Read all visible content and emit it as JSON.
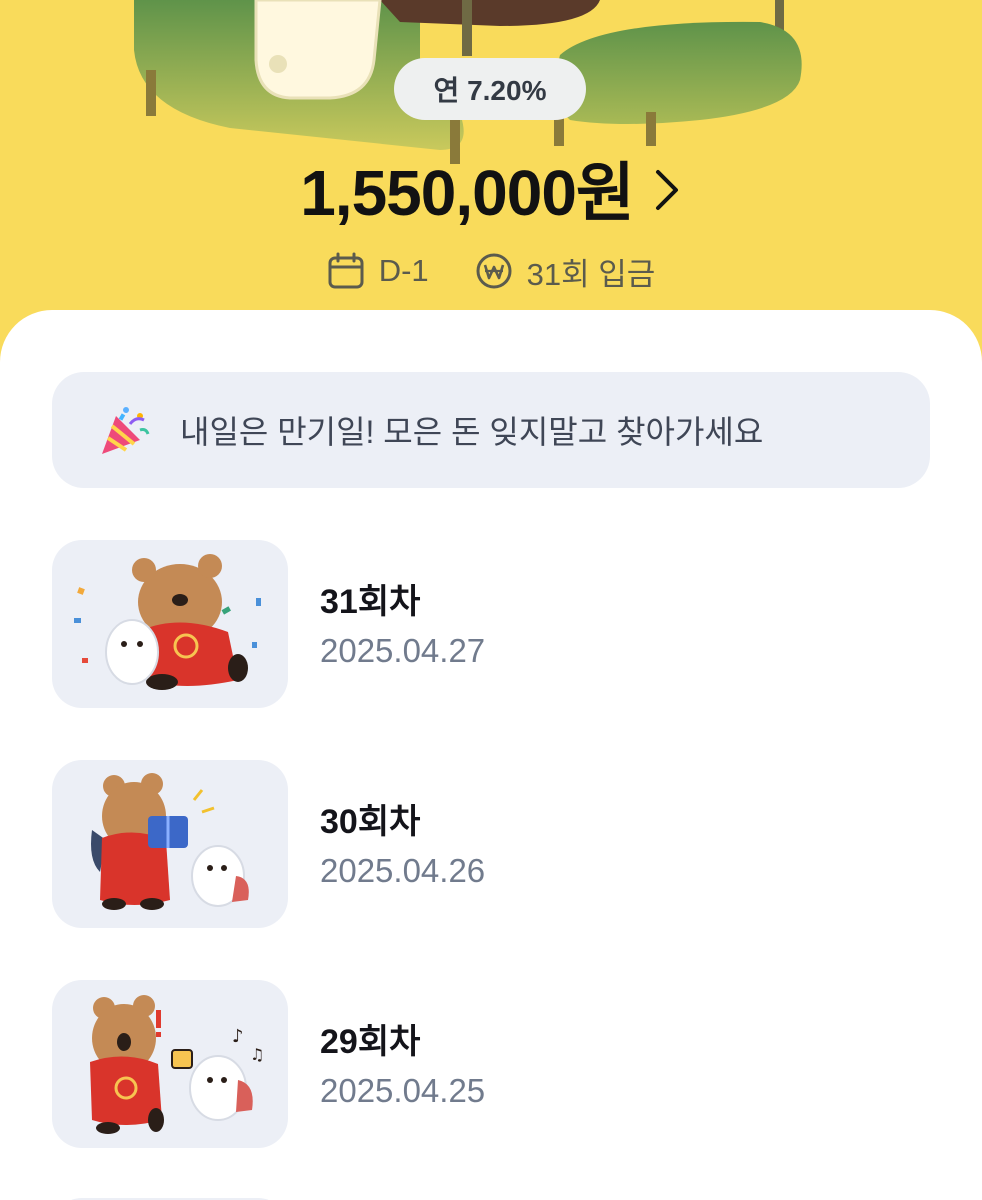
{
  "header": {
    "rate_label": "연 7.20%",
    "amount": "1,550,000원",
    "dday": "D-1",
    "deposit_count": "31회 입금"
  },
  "notice": {
    "text": "내일은 만기일! 모은 돈 잊지말고 찾아가세요",
    "icon": "party-popper-icon"
  },
  "deposits": [
    {
      "title": "31회차",
      "date": "2025.04.27"
    },
    {
      "title": "30회차",
      "date": "2025.04.26"
    },
    {
      "title": "29회차",
      "date": "2025.04.25"
    }
  ],
  "colors": {
    "header_bg": "#f9db5b",
    "sheet_bg": "#ffffff",
    "card_bg": "#eceff6",
    "title_text": "#14141a",
    "date_text": "#717b8d"
  }
}
